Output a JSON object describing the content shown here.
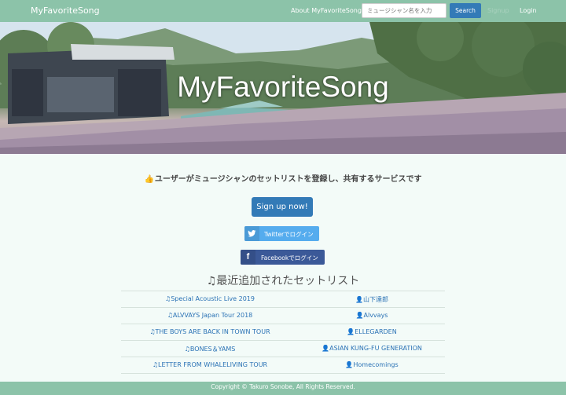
{
  "navbar": {
    "brand": "MyFavoriteSong",
    "about": "About MyFavoriteSong",
    "search_placeholder": "ミュージシャン名を入力",
    "search_button": "Search",
    "signup": "Signup",
    "login": "Login"
  },
  "hero": {
    "title": "MyFavoriteSong"
  },
  "tagline": {
    "icon": "👍",
    "text": "ユーザーがミュージシャンのセットリストを登録し、共有するサービスです"
  },
  "buttons": {
    "signup": "Sign up now!",
    "twitter": "Twitterでログイン",
    "facebook": "Facebookでログイン",
    "facebook_icon": "f"
  },
  "section": {
    "icon": "♫",
    "title": "最近追加されたセットリスト"
  },
  "setlists": [
    {
      "tour": "Special Acoustic Live 2019",
      "artist": "山下達郎"
    },
    {
      "tour": "ALVVAYS Japan Tour 2018",
      "artist": "Alvvays"
    },
    {
      "tour": "THE BOYS ARE BACK IN TOWN TOUR",
      "artist": "ELLEGARDEN"
    },
    {
      "tour": "BONES＆YAMS",
      "artist": "ASIAN KUNG-FU GENERATION"
    },
    {
      "tour": "LETTER FROM WHALELIVING TOUR",
      "artist": "Homecomings"
    }
  ],
  "footer": {
    "copyright": "Copyright © Takuro Sonobe, All Rights Reserved."
  },
  "colors": {
    "navbar": "#8cc3a9",
    "primary": "#337ab7",
    "twitter": "#55acee",
    "facebook": "#3b5998",
    "link": "#2a72b5"
  },
  "icons": {
    "tour": "music-note-icon",
    "artist": "person-icon"
  }
}
